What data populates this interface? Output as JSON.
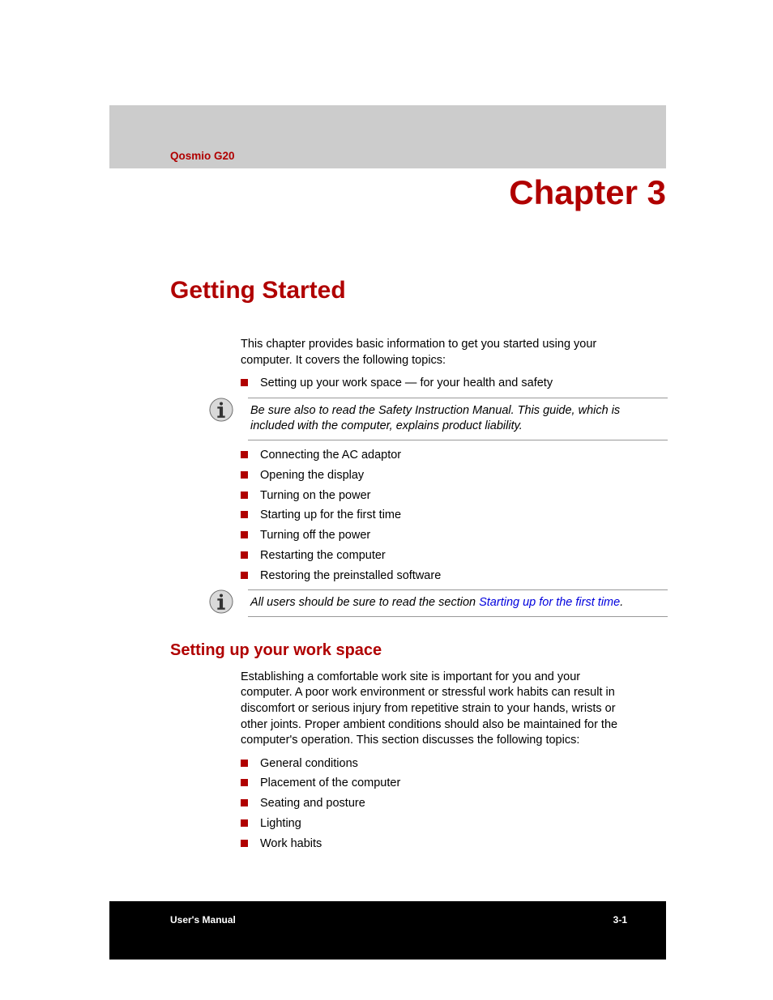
{
  "header": {
    "product": "Qosmio G20",
    "chapter": "Chapter 3"
  },
  "section": {
    "title": "Getting Started",
    "intro": "This chapter provides basic information to get you started using your computer. It covers the following topics:",
    "topics1": [
      "Setting up your work space — for your health and safety"
    ],
    "note1": "Be sure also to read the Safety Instruction Manual. This guide, which is included with the computer, explains product liability.",
    "topics2": [
      "Connecting the AC adaptor",
      "Opening the display",
      "Turning on the power",
      "Starting up for the first time",
      "Turning off the power",
      "Restarting the computer",
      "Restoring the preinstalled software"
    ],
    "note2_prefix": "All users should be sure to read the section ",
    "note2_link": "Starting up for the first time",
    "note2_suffix": "."
  },
  "subsection": {
    "title": "Setting up your work space",
    "intro": "Establishing a comfortable work site is important for you and your computer. A poor work environment or stressful work habits can result in discomfort or serious injury from repetitive strain to your hands, wrists or other joints. Proper ambient conditions should also be maintained for the computer's operation. This section discusses the following topics:",
    "topics": [
      "General conditions",
      "Placement of the computer",
      "Seating and posture",
      "Lighting",
      "Work habits"
    ]
  },
  "footer": {
    "left": "User's Manual",
    "right": "3-1"
  }
}
